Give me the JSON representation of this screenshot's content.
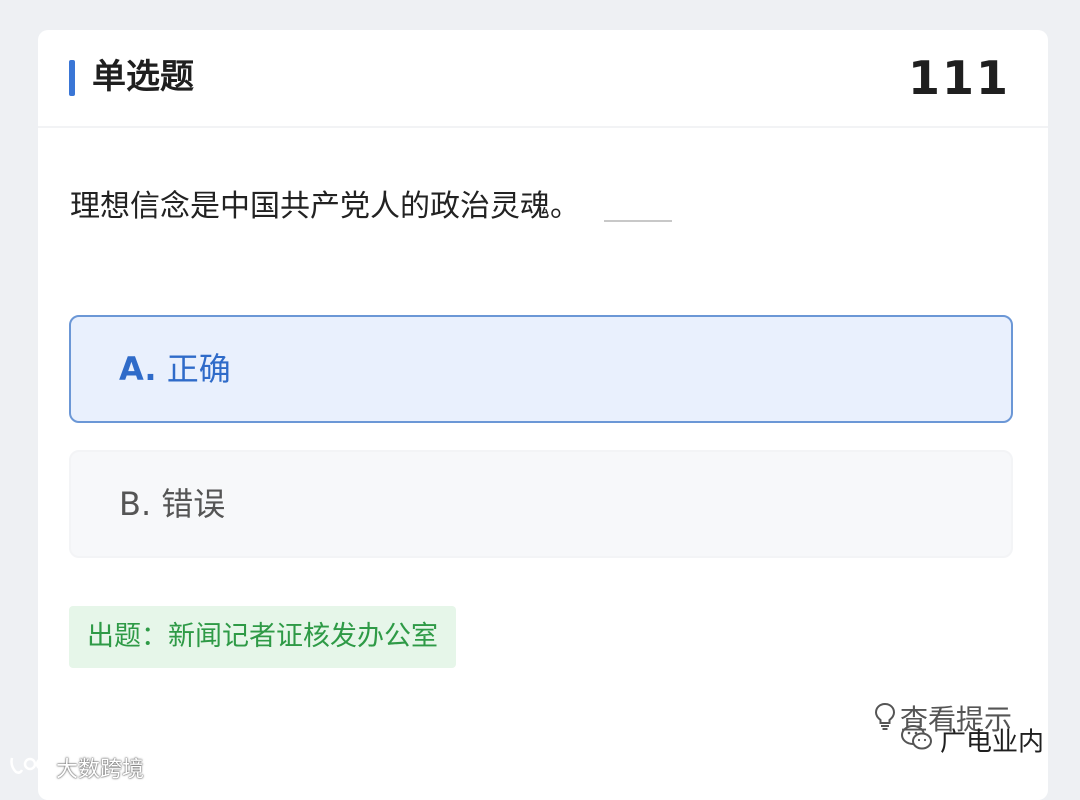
{
  "header": {
    "title": "单选题",
    "question_number": "111"
  },
  "question": {
    "text": "理想信念是中国共产党人的政治灵魂。"
  },
  "options": [
    {
      "letter": "A.",
      "text": "正确",
      "selected": true
    },
    {
      "letter": "B.",
      "text": "错误",
      "selected": false
    }
  ],
  "source": {
    "label": "出题：新闻记者证核发办公室"
  },
  "hint": {
    "label": "查看提示",
    "icon": "lightbulb-icon"
  },
  "watermarks": {
    "left": "大数跨境",
    "right": "广电业内"
  },
  "colors": {
    "accent": "#3a76d6",
    "selected_bg": "#e9f0fd",
    "selected_border": "#6b97d6",
    "source_bg": "#e6f6e9",
    "source_text": "#2e9a46"
  }
}
